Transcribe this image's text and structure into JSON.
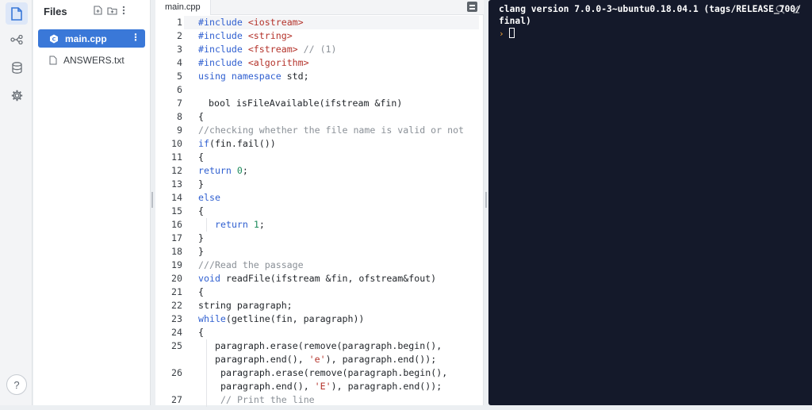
{
  "sidebar": {
    "title": "Files",
    "files": [
      {
        "name": "main.cpp",
        "active": true
      },
      {
        "name": "ANSWERS.txt",
        "active": false
      }
    ],
    "help_label": "?"
  },
  "editor": {
    "tab": "main.cpp",
    "lines": [
      {
        "n": "1"
      },
      {
        "n": "2"
      },
      {
        "n": "3"
      },
      {
        "n": "4"
      },
      {
        "n": "5"
      },
      {
        "n": "6"
      },
      {
        "n": "7"
      },
      {
        "n": "8"
      },
      {
        "n": "9"
      },
      {
        "n": "10"
      },
      {
        "n": "11"
      },
      {
        "n": "12"
      },
      {
        "n": "13"
      },
      {
        "n": "14"
      },
      {
        "n": "15"
      },
      {
        "n": "16"
      },
      {
        "n": "17"
      },
      {
        "n": "18"
      },
      {
        "n": "19"
      },
      {
        "n": "20"
      },
      {
        "n": "21"
      },
      {
        "n": "22"
      },
      {
        "n": "23"
      },
      {
        "n": "24"
      },
      {
        "n": "25"
      },
      {
        "n": "26"
      },
      {
        "n": "27"
      }
    ],
    "code": {
      "l1_kw": "#include ",
      "l1_str": "<iostream>",
      "l2_kw": "#include ",
      "l2_str": "<string>",
      "l3_kw": "#include ",
      "l3_str": "<fstream>",
      "l3_cm": " // (1)",
      "l4_kw": "#include ",
      "l4_str": "<algorithm>",
      "l5_kw": "using namespace",
      "l5_rest": " std;",
      "l7": "bool isFileAvailable(ifstream &fin)",
      "l8": "{",
      "l9": "//checking whether the file name is valid or not",
      "l10_kw": "if",
      "l10_rest": "(fin.fail())",
      "l11": "{",
      "l12_kw": "return ",
      "l12_num": "0",
      "l12_end": ";",
      "l13": "}",
      "l14_kw": "else",
      "l15": "{",
      "l16_kw": "return ",
      "l16_num": "1",
      "l16_end": ";",
      "l17": "}",
      "l18": "}",
      "l19": "///Read the passage",
      "l20_kw": "void",
      "l20_rest": " readFile(ifstream &fin, ofstream&fout)",
      "l21": "{",
      "l22": "string paragraph;",
      "l23_kw": "while",
      "l23_rest": "(getline(fin, paragraph))",
      "l24": "{",
      "l25a": "paragraph.erase(remove(paragraph.begin(),",
      "l25b_pre": "paragraph.end(), ",
      "l25b_str": "'e'",
      "l25b_post": "), paragraph.end());",
      "l26a": "paragraph.erase(remove(paragraph.begin(),",
      "l26b_pre": "paragraph.end(), ",
      "l26b_str": "'E'",
      "l26b_post": "), paragraph.end());",
      "l27": "// Print the line"
    }
  },
  "console": {
    "output": "clang version 7.0.0-3~ubuntu0.18.04.1 (tags/RELEASE_700/final)",
    "prompt": "›"
  },
  "colors": {
    "accent": "#3a78d8",
    "console_bg": "#14192a",
    "keyword": "#2f5fd0",
    "string": "#b4332b",
    "number": "#1b8a5a",
    "comment": "#8a9097"
  }
}
